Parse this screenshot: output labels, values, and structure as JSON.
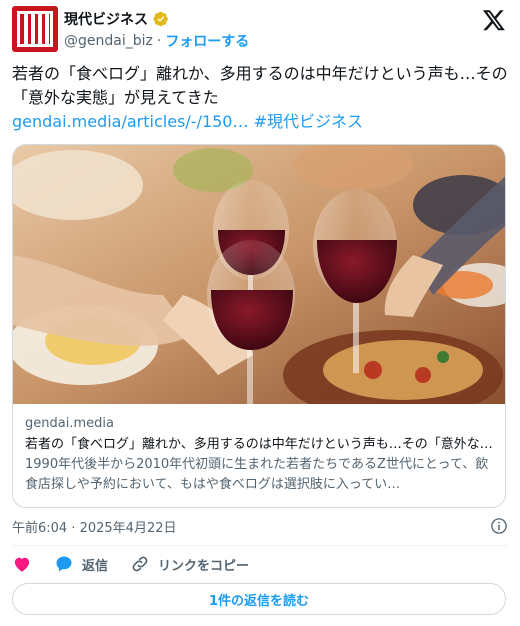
{
  "author": {
    "display_name": "現代ビジネス",
    "handle": "@gendai_biz",
    "separator": "·",
    "follow_label": "フォローする",
    "avatar_icon": "gendai-logo-icon",
    "verified_icon": "verified-gold-badge-icon"
  },
  "tweet": {
    "text": "若者の「食べログ」離れか、多用するのは中年だけという声も…その「意外な実態」が見えてきた",
    "link_text": "gendai.media/articles/-/150…",
    "hashtag": "#現代ビジネス"
  },
  "card": {
    "image_desc_icon": "wine-toast-photo",
    "domain": "gendai.media",
    "title": "若者の「食べログ」離れか、多用するのは中年だけという声も…その「意外な実態」が見えてきた",
    "description": "1990年代後半から2010年代初頭に生まれた若者たちであるZ世代にとって、飲食店探しや予約において、もはや食べログは選択肢に入ってい…"
  },
  "meta": {
    "timestamp": "午前6:04 · 2025年4月22日"
  },
  "actions": {
    "like_icon": "heart-icon",
    "reply_label": "返信",
    "copy_link_label": "リンクをコピー"
  },
  "footer": {
    "read_replies_label": "1件の返信を読む"
  },
  "colors": {
    "brand_red": "#c8141e",
    "accent_blue": "#1d9bf0",
    "like_pink": "#f91880",
    "muted_text": "#536471",
    "verified_gold": "#e2b719"
  }
}
